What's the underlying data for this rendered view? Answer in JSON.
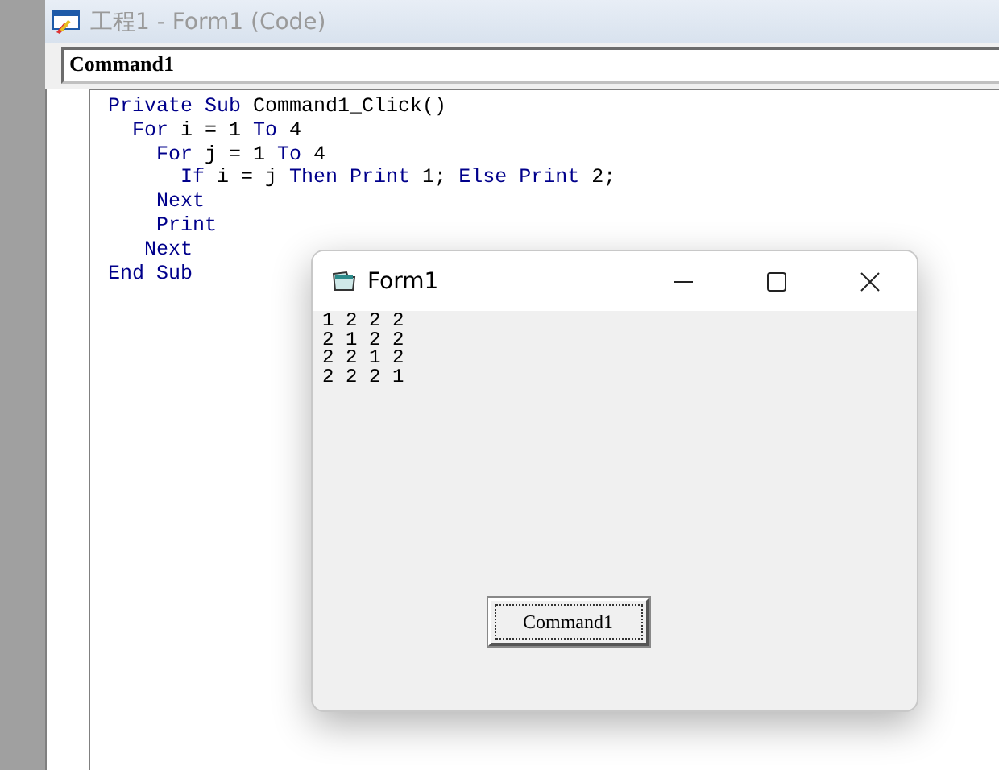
{
  "window": {
    "title": "工程1 - Form1 (Code)",
    "active": false
  },
  "object_combo": {
    "value": "Command1"
  },
  "code_lines": [
    [
      {
        "kind": "keyword",
        "text": "Private Sub"
      },
      {
        "kind": "plain",
        "text": " Command1_Click()"
      }
    ],
    [
      {
        "kind": "keyword",
        "text": "  For"
      },
      {
        "kind": "plain",
        "text": " i = 1 "
      },
      {
        "kind": "keyword",
        "text": "To"
      },
      {
        "kind": "plain",
        "text": " 4"
      }
    ],
    [
      {
        "kind": "keyword",
        "text": "    For"
      },
      {
        "kind": "plain",
        "text": " j = 1 "
      },
      {
        "kind": "keyword",
        "text": "To"
      },
      {
        "kind": "plain",
        "text": " 4"
      }
    ],
    [
      {
        "kind": "keyword",
        "text": "      If"
      },
      {
        "kind": "plain",
        "text": " i = j "
      },
      {
        "kind": "keyword",
        "text": "Then Print"
      },
      {
        "kind": "plain",
        "text": " 1; "
      },
      {
        "kind": "keyword",
        "text": "Else Print"
      },
      {
        "kind": "plain",
        "text": " 2;"
      }
    ],
    [
      {
        "kind": "keyword",
        "text": "    Next"
      }
    ],
    [
      {
        "kind": "keyword",
        "text": "    Print"
      }
    ],
    [
      {
        "kind": "keyword",
        "text": "   Next"
      }
    ],
    [
      {
        "kind": "keyword",
        "text": "End Sub"
      }
    ]
  ],
  "form_window": {
    "title": "Form1",
    "output_rows": [
      [
        "1",
        "2",
        "2",
        "2"
      ],
      [
        "2",
        "1",
        "2",
        "2"
      ],
      [
        "2",
        "2",
        "1",
        "2"
      ],
      [
        "2",
        "2",
        "2",
        "1"
      ]
    ],
    "button": {
      "label": "Command1",
      "focused": true
    }
  }
}
